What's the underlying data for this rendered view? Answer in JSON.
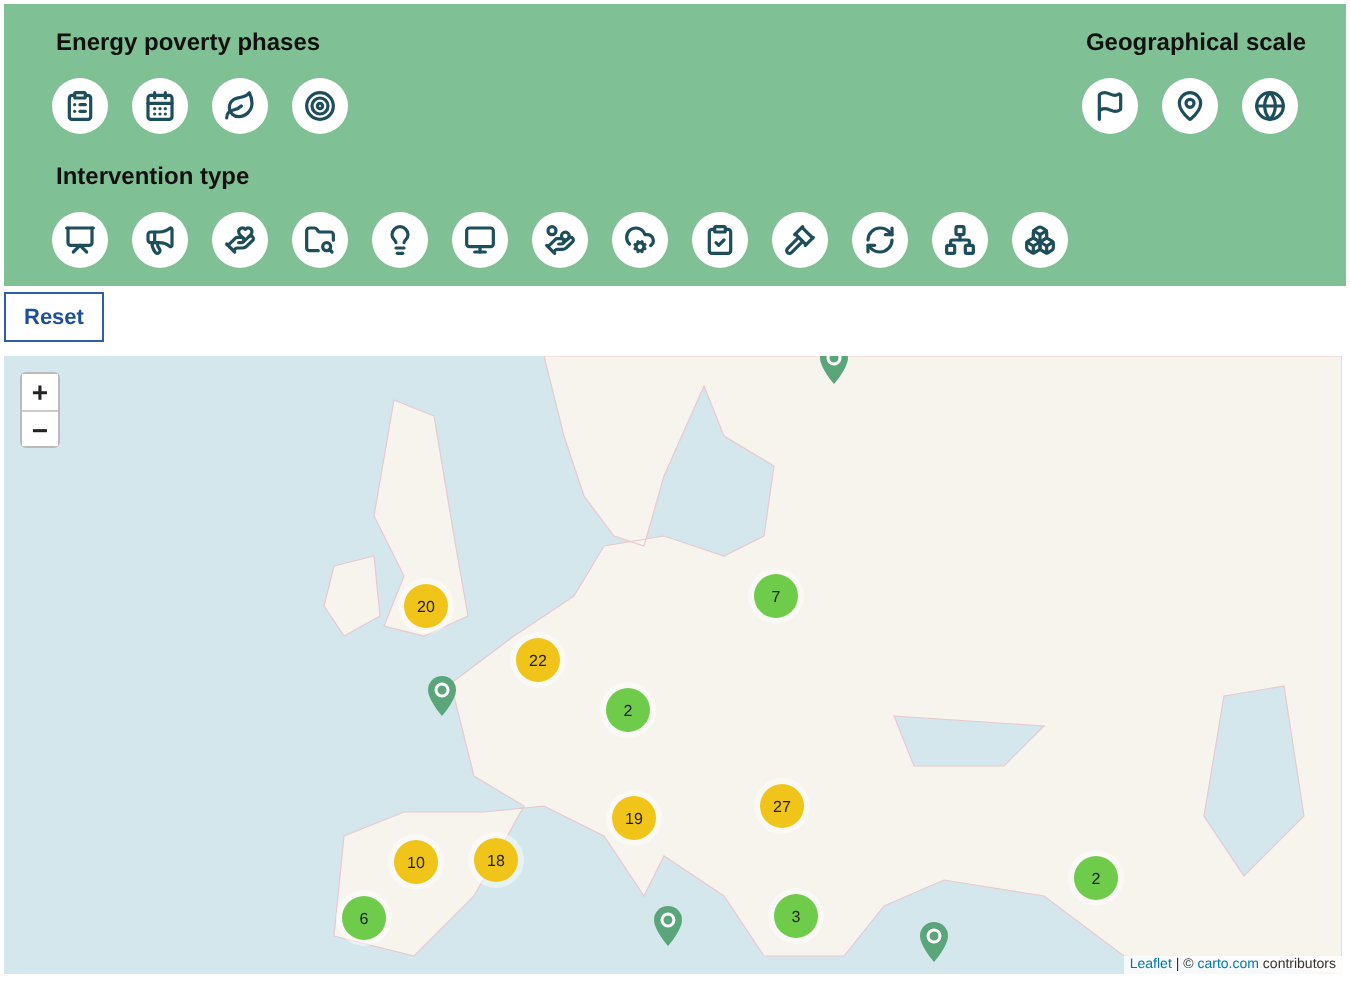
{
  "filters": {
    "phases": {
      "title": "Energy poverty phases"
    },
    "scale": {
      "title": "Geographical scale"
    },
    "intervention": {
      "title": "Intervention type"
    }
  },
  "reset_button": "Reset",
  "map": {
    "zoom_in": "+",
    "zoom_out": "−",
    "clusters": [
      {
        "count": "20",
        "color": "#f0c419"
      },
      {
        "count": "22",
        "color": "#f0c419"
      },
      {
        "count": "2",
        "color": "#6ecc4a"
      },
      {
        "count": "7",
        "color": "#6ecc4a"
      },
      {
        "count": "19",
        "color": "#f0c419"
      },
      {
        "count": "27",
        "color": "#f0c419"
      },
      {
        "count": "10",
        "color": "#f0c419"
      },
      {
        "count": "18",
        "color": "#f0c419"
      },
      {
        "count": "6",
        "color": "#6ecc4a"
      },
      {
        "count": "3",
        "color": "#6ecc4a"
      },
      {
        "count": "2",
        "color": "#6ecc4a"
      }
    ],
    "attribution": {
      "leaflet": "Leaflet",
      "middle": "| ©",
      "provider": "carto.com",
      "suffix": "contributors"
    }
  }
}
